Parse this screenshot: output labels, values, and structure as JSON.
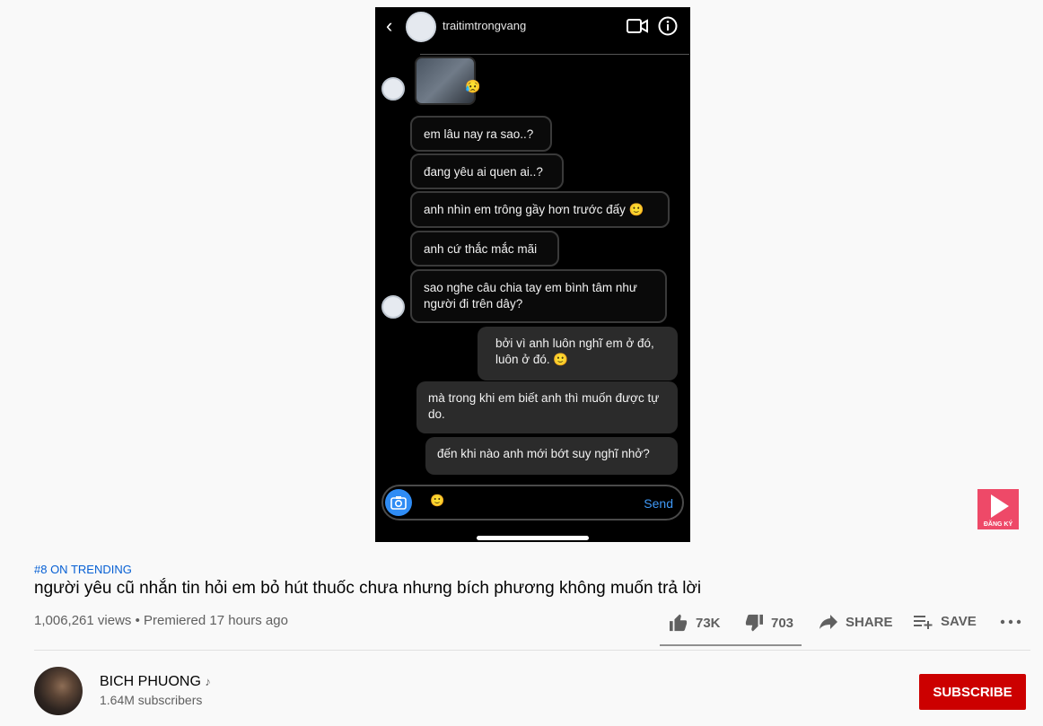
{
  "video": {
    "header": {
      "username": "traitimtrongvang"
    },
    "messages": [
      {
        "text": "em lâu nay ra sao..?"
      },
      {
        "text": "đang yêu ai quen ai..?"
      },
      {
        "text": "anh nhìn em trông gầy hơn trước đấy"
      },
      {
        "text": "anh cứ thắc mắc mãi"
      },
      {
        "text": "sao nghe câu chia tay em bình tâm như người đi trên dây?"
      },
      {
        "text": "bởi vì anh luôn nghĩ em ở đó, luôn ở đó."
      },
      {
        "text": "mà trong khi em biết anh thì muốn được tự do."
      },
      {
        "text": "đến khi nào anh mới bớt suy nghĩ nhở?"
      }
    ],
    "composer": {
      "send_label": "Send"
    }
  },
  "watermark": {
    "label": "ĐĂNG KÝ"
  },
  "info": {
    "trending": "#8 ON TRENDING",
    "title": "người yêu cũ nhắn tin hỏi em bỏ hút thuốc chưa nhưng bích phương không muốn trả lời",
    "views": "1,006,261 views",
    "premiered": "Premiered 17 hours ago",
    "likes": "73K",
    "dislikes": "703",
    "share_label": "SHARE",
    "save_label": "SAVE",
    "like_ratio": 0.99
  },
  "channel": {
    "name": "BICH PHUONG",
    "subscribers": "1.64M subscribers",
    "subscribe_label": "SUBSCRIBE"
  }
}
